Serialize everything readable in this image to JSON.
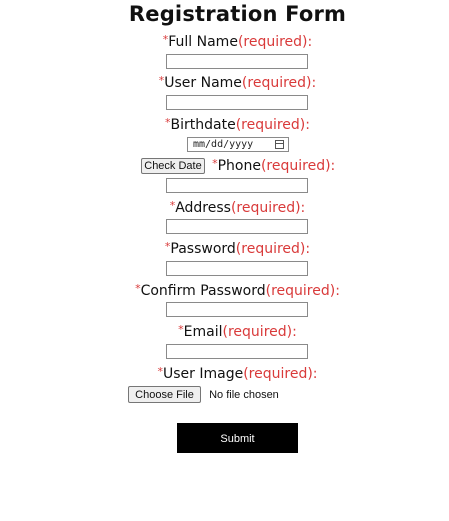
{
  "form": {
    "title": "Registration Form",
    "required_marker": "*",
    "required_text": "(required):",
    "fields": {
      "full_name": {
        "label": "Full Name",
        "value": ""
      },
      "user_name": {
        "label": "User Name",
        "value": ""
      },
      "birthdate": {
        "label": "Birthdate",
        "placeholder": "mm/dd/yyyy",
        "check_button": "Check Date"
      },
      "phone": {
        "label": "Phone",
        "value": ""
      },
      "address": {
        "label": "Address",
        "value": ""
      },
      "password": {
        "label": "Password",
        "value": ""
      },
      "confirm_password": {
        "label": "Confirm Password",
        "value": ""
      },
      "email": {
        "label": "Email",
        "value": ""
      },
      "user_image": {
        "label": "User Image",
        "button": "Choose File",
        "status": "No file chosen"
      }
    },
    "submit_label": "Submit"
  },
  "colors": {
    "required": "#d93a3a",
    "submit_bg": "#000000",
    "submit_text": "#ffffff"
  }
}
